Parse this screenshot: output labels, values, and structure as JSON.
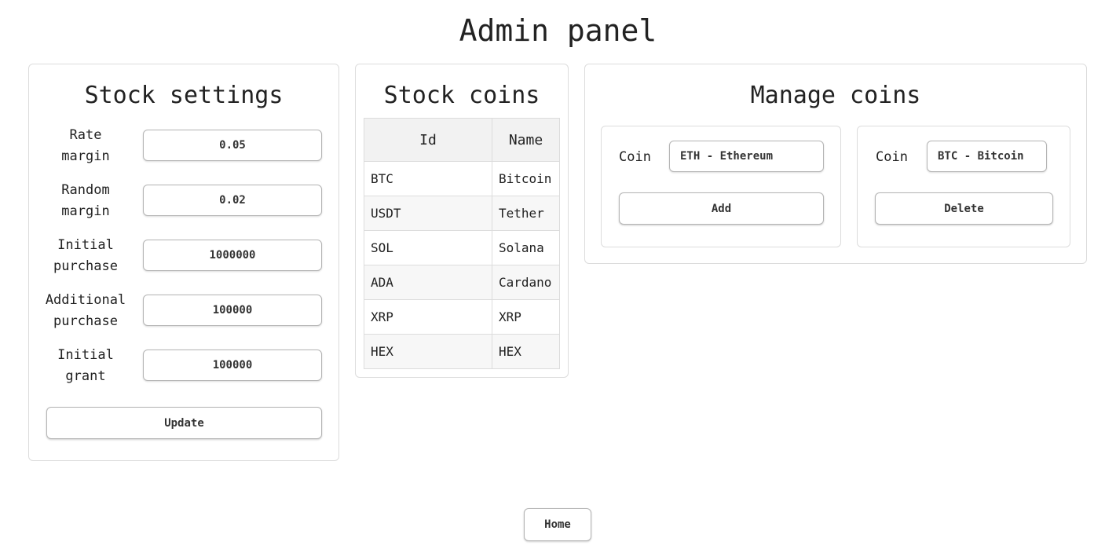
{
  "page": {
    "title": "Admin panel"
  },
  "stock_settings": {
    "title": "Stock settings",
    "fields": [
      {
        "label_line1": "Rate",
        "label_line2": "margin",
        "value": "0.05"
      },
      {
        "label_line1": "Random",
        "label_line2": "margin",
        "value": "0.02"
      },
      {
        "label_line1": "Initial",
        "label_line2": "purchase",
        "value": "1000000"
      },
      {
        "label_line1": "Additional",
        "label_line2": "purchase",
        "value": "100000"
      },
      {
        "label_line1": "Initial",
        "label_line2": "grant",
        "value": "100000"
      }
    ],
    "update_label": "Update"
  },
  "stock_coins": {
    "title": "Stock coins",
    "columns": [
      "Id",
      "Name"
    ],
    "rows": [
      [
        "BTC",
        "Bitcoin"
      ],
      [
        "USDT",
        "Tether"
      ],
      [
        "SOL",
        "Solana"
      ],
      [
        "ADA",
        "Cardano"
      ],
      [
        "XRP",
        "XRP"
      ],
      [
        "HEX",
        "HEX"
      ]
    ]
  },
  "manage_coins": {
    "title": "Manage coins",
    "add_panel": {
      "coin_label": "Coin",
      "selected": "ETH - Ethereum",
      "button_label": "Add"
    },
    "delete_panel": {
      "coin_label": "Coin",
      "selected": "BTC - Bitcoin",
      "button_label": "Delete"
    }
  },
  "footer": {
    "home_label": "Home"
  }
}
